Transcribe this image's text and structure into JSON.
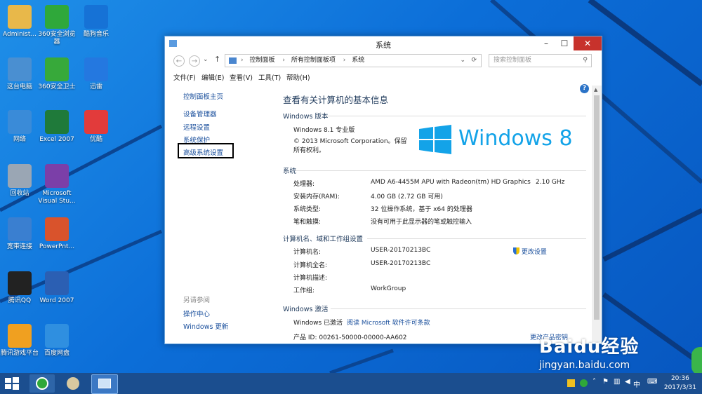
{
  "desktop_icons": [
    {
      "label": "Administ...",
      "icon": "folder-icon",
      "color": "#e8b84a"
    },
    {
      "label": "360安全浏览器",
      "icon": "browser-360-icon",
      "color": "#2fa83a"
    },
    {
      "label": "酷狗音乐",
      "icon": "kugou-icon",
      "color": "#1672d6"
    },
    {
      "label": "这台电脑",
      "icon": "computer-icon",
      "color": "#4a8fd1"
    },
    {
      "label": "360安全卫士",
      "icon": "security-360-icon",
      "color": "#37a93a"
    },
    {
      "label": "迅雷",
      "icon": "thunder-icon",
      "color": "#2478e0"
    },
    {
      "label": "网络",
      "icon": "network-icon",
      "color": "#3a8bd8"
    },
    {
      "label": "Excel 2007",
      "icon": "excel-icon",
      "color": "#1f7a3a"
    },
    {
      "label": "优酷",
      "icon": "youku-icon",
      "color": "#e23b3b"
    },
    {
      "label": "回收站",
      "icon": "recycle-bin-icon",
      "color": "#9aa6b4"
    },
    {
      "label": "Microsoft Visual Stu...",
      "icon": "visual-studio-icon",
      "color": "#7b3fa8"
    },
    {
      "label": "宽带连接",
      "icon": "broadband-icon",
      "color": "#3a7fd0"
    },
    {
      "label": "PowerPnt...",
      "icon": "powerpoint-icon",
      "color": "#d9532c"
    },
    {
      "label": "腾讯QQ",
      "icon": "qq-icon",
      "color": "#222222"
    },
    {
      "label": "Word 2007",
      "icon": "word-icon",
      "color": "#2b5fb3"
    },
    {
      "label": "腾讯游戏平台",
      "icon": "tencent-games-icon",
      "color": "#f0a020"
    },
    {
      "label": "百度网盘",
      "icon": "baidu-netdisk-icon",
      "color": "#2f8fe0"
    }
  ],
  "window": {
    "title": "系统",
    "breadcrumbs": [
      "控制面板",
      "所有控制面板项",
      "系统"
    ],
    "search_placeholder": "搜索控制面板",
    "menu": [
      "文件(F)",
      "编辑(E)",
      "查看(V)",
      "工具(T)",
      "帮助(H)"
    ],
    "left_links": [
      "控制面板主页",
      "设备管理器",
      "远程设置",
      "系统保护",
      "高级系统设置"
    ],
    "see_also_title": "另请参阅",
    "see_also": [
      "操作中心",
      "Windows 更新"
    ],
    "heading": "查看有关计算机的基本信息",
    "edition_section": "Windows 版本",
    "edition": "Windows 8.1 专业版",
    "copyright": "© 2013 Microsoft Corporation。保留所有权利。",
    "logo_text": "Windows 8",
    "system_section": "系统",
    "system_rows": [
      {
        "k": "处理器:",
        "v": "AMD A6-4455M APU with Radeon(tm) HD Graphics",
        "extra": "2.10 GHz"
      },
      {
        "k": "安装内存(RAM):",
        "v": "4.00 GB (2.72 GB 可用)"
      },
      {
        "k": "系统类型:",
        "v": "32 位操作系统，基于 x64 的处理器"
      },
      {
        "k": "笔和触摸:",
        "v": "没有可用于此显示器的笔或触控输入"
      }
    ],
    "computer_section": "计算机名、域和工作组设置",
    "computer_rows": [
      {
        "k": "计算机名:",
        "v": "USER-20170213BC"
      },
      {
        "k": "计算机全名:",
        "v": "USER-20170213BC"
      },
      {
        "k": "计算机描述:",
        "v": ""
      },
      {
        "k": "工作组:",
        "v": "WorkGroup"
      }
    ],
    "change_settings": "更改设置",
    "activation_section": "Windows 激活",
    "activation_status": "Windows 已激活",
    "activation_link": "阅读 Microsoft 软件许可条款",
    "product_id": "产品 ID: 00261-50000-00000-AA602",
    "change_key": "更改产品密钥"
  },
  "taskbar": {
    "time": "20:36",
    "date": "2017/3/31",
    "ime": "中"
  },
  "watermark": {
    "brand": "Baidu经验",
    "url": "jingyan.baidu.com"
  }
}
